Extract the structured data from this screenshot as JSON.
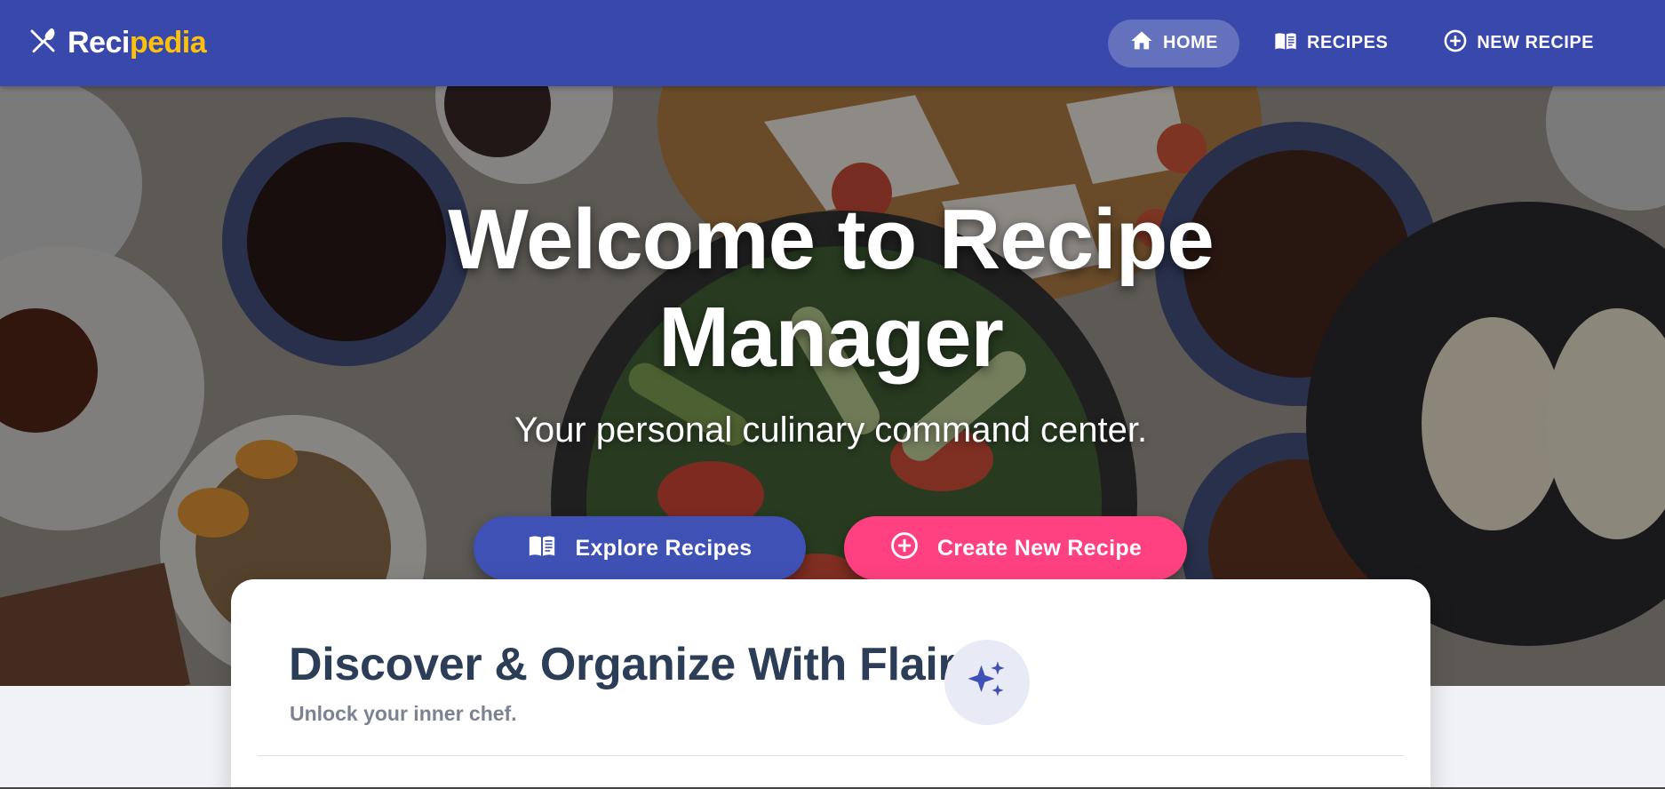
{
  "brand": {
    "name_part1": "Reci",
    "name_part2": "pedia",
    "icon": "utensils-icon"
  },
  "nav": {
    "items": [
      {
        "label": "HOME",
        "icon": "home-icon",
        "active": true
      },
      {
        "label": "RECIPES",
        "icon": "book-icon",
        "active": false
      },
      {
        "label": "NEW RECIPE",
        "icon": "plus-circle-icon",
        "active": false
      }
    ]
  },
  "hero": {
    "title": "Welcome to Recipe Manager",
    "subtitle": "Your personal culinary command center.",
    "explore_button": {
      "label": "Explore Recipes",
      "icon": "book-icon"
    },
    "create_button": {
      "label": "Create New Recipe",
      "icon": "plus-circle-icon"
    }
  },
  "card": {
    "title": "Discover & Organize With Flair",
    "subtitle": "Unlock your inner chef.",
    "icon": "sparkles-icon"
  },
  "colors": {
    "primary": "#3949ab",
    "accent": "#ff4081",
    "brand_highlight": "#ffc107",
    "card_title": "#2c3e57"
  }
}
